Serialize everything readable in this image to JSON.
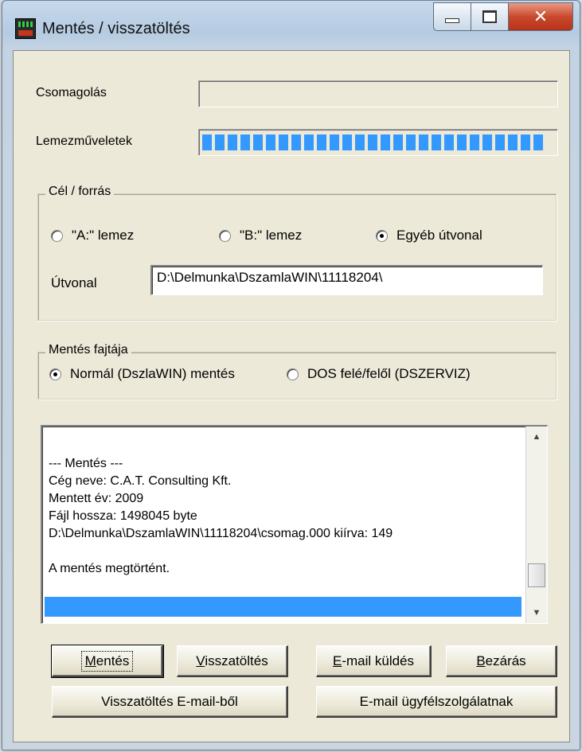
{
  "window": {
    "title": "Mentés / visszatöltés",
    "icon": "app-icon",
    "caption": {
      "minimize": "minimize-icon",
      "maximize": "maximize-icon",
      "close": "close-icon"
    }
  },
  "progress": {
    "packing_label": "Csomagolás",
    "packing_value": 0,
    "disk_label": "Lemezműveletek",
    "disk_value": 1.0,
    "accent": "#3399ff"
  },
  "target_group": {
    "legend": "Cél / forrás",
    "options": [
      "\"A:\" lemez",
      "\"B:\" lemez",
      "Egyéb útvonal"
    ],
    "selected": "Egyéb útvonal",
    "path_label": "Útvonal",
    "path_value": "D:\\Delmunka\\DszamlaWIN\\11118204\\"
  },
  "save_type_group": {
    "legend": "Mentés fajtája",
    "options": [
      "Normál (DszlaWIN) mentés",
      "DOS felé/felől (DSZERVIZ)"
    ],
    "selected": "Normál (DszlaWIN) mentés"
  },
  "log": {
    "lines": [
      "--- Mentés ---",
      "Cég neve: C.A.T. Consulting Kft.",
      "Mentett év: 2009",
      "Fájl hossza: 1498045 byte",
      "D:\\Delmunka\\DszamlaWIN\\11118204\\csomag.000 kiírva: 149",
      "",
      "A mentés megtörtént."
    ]
  },
  "buttons": {
    "save": {
      "accel": "M",
      "rest": "entés"
    },
    "restore": {
      "accel": "V",
      "rest": "isszatöltés"
    },
    "email_send": {
      "accel": "E",
      "rest": "-mail küldés"
    },
    "close": {
      "accel": "B",
      "rest": "ezárás"
    },
    "restore_from_email": "Visszatöltés E-mail-ből",
    "email_support": "E-mail ügyfélszolgálatnak"
  }
}
